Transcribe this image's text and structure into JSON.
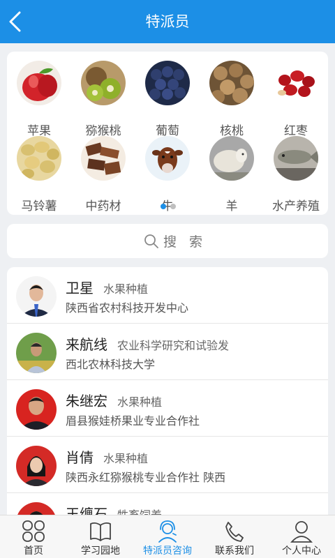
{
  "header": {
    "title": "特派员"
  },
  "categories": [
    {
      "label": "苹果",
      "icon": "apple"
    },
    {
      "label": "猕猴桃",
      "icon": "kiwi"
    },
    {
      "label": "葡萄",
      "icon": "grape"
    },
    {
      "label": "核桃",
      "icon": "walnut"
    },
    {
      "label": "红枣",
      "icon": "jujube"
    },
    {
      "label": "马铃薯",
      "icon": "potato"
    },
    {
      "label": "中药材",
      "icon": "herb"
    },
    {
      "label": "牛",
      "icon": "cattle"
    },
    {
      "label": "羊",
      "icon": "sheep"
    },
    {
      "label": "水产养殖",
      "icon": "fish"
    }
  ],
  "pager": {
    "pages": 2,
    "current": 1
  },
  "search": {
    "label": "搜 索"
  },
  "experts": [
    {
      "name": "卫星",
      "field": "水果种植",
      "org": "陕西省农村科技开发中心"
    },
    {
      "name": "来航线",
      "field": "农业科学研究和试验发",
      "org": "西北农林科技大学"
    },
    {
      "name": "朱继宏",
      "field": "水果种植",
      "org": "眉县猴娃桥果业专业合作社"
    },
    {
      "name": "肖倩",
      "field": "水果种植",
      "org": "陕西永红猕猴桃专业合作社   陕西"
    },
    {
      "name": "王缠石",
      "field": "牲畜饲养",
      "org": ""
    }
  ],
  "tabs": [
    {
      "label": "首页",
      "icon": "home-icon"
    },
    {
      "label": "学习园地",
      "icon": "book-icon"
    },
    {
      "label": "特派员咨询",
      "icon": "consultant-icon"
    },
    {
      "label": "联系我们",
      "icon": "phone-icon"
    },
    {
      "label": "个人中心",
      "icon": "user-icon"
    }
  ],
  "colors": {
    "primary": "#1c8fe6",
    "background": "#eef0f3",
    "inactive_dot": "#bfbfbf"
  }
}
